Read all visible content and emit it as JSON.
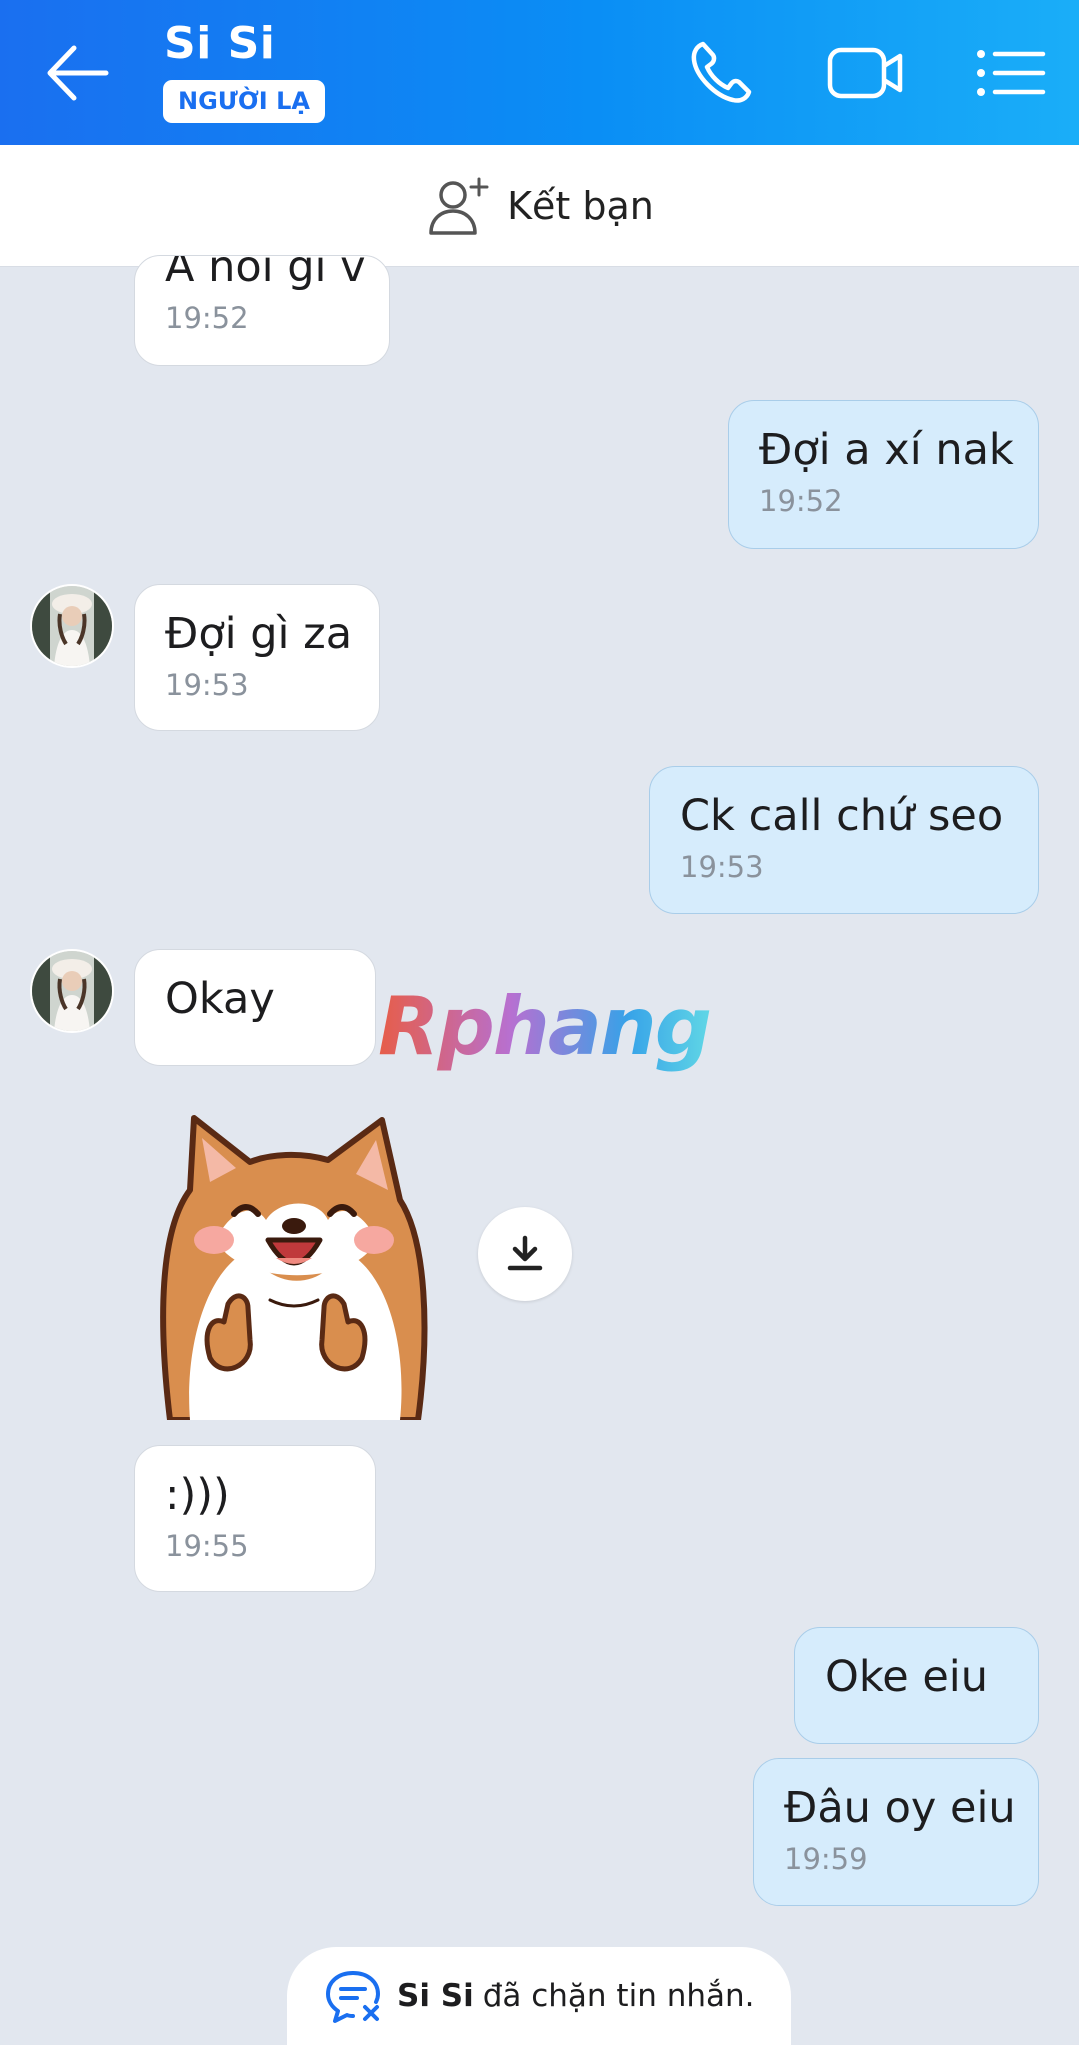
{
  "header": {
    "contact_name": "Si Si",
    "badge": "NGƯỜI LẠ",
    "icons": [
      "back-arrow-icon",
      "phone-icon",
      "video-camera-icon",
      "list-menu-icon"
    ],
    "gradient": [
      "#1a6ff0",
      "#1aaef8"
    ]
  },
  "friend_bar": {
    "label": "Kết bạn",
    "icon": "add-friend-icon"
  },
  "messages": [
    {
      "dir": "in",
      "text": "A nói gì v",
      "time": "19:52"
    },
    {
      "dir": "out",
      "text": "Đợi a xí nak",
      "time": "19:52"
    },
    {
      "dir": "in",
      "text": "Đợi gì za",
      "time": "19:53"
    },
    {
      "dir": "out",
      "text": "Ck call chứ seo",
      "time": "19:53"
    },
    {
      "dir": "in",
      "text": "Okay",
      "time": ""
    },
    {
      "dir": "in",
      "type": "sticker",
      "sticker": "shiba-dog-thumbs-up"
    },
    {
      "dir": "in",
      "text": ":)))",
      "time": "19:55"
    },
    {
      "dir": "out",
      "text": "Oke eiu",
      "time": ""
    },
    {
      "dir": "out",
      "text": "Đâu oy eiu",
      "time": "19:59"
    }
  ],
  "watermark": "Rphang",
  "blocked_notice": {
    "name": "Si Si",
    "text": "đã chặn tin nhắn."
  },
  "colors": {
    "incoming": "#ffffff",
    "outgoing": "#d6ecfc",
    "chat_bg": "#e2e7ef",
    "accent": "#1a6ff0"
  }
}
